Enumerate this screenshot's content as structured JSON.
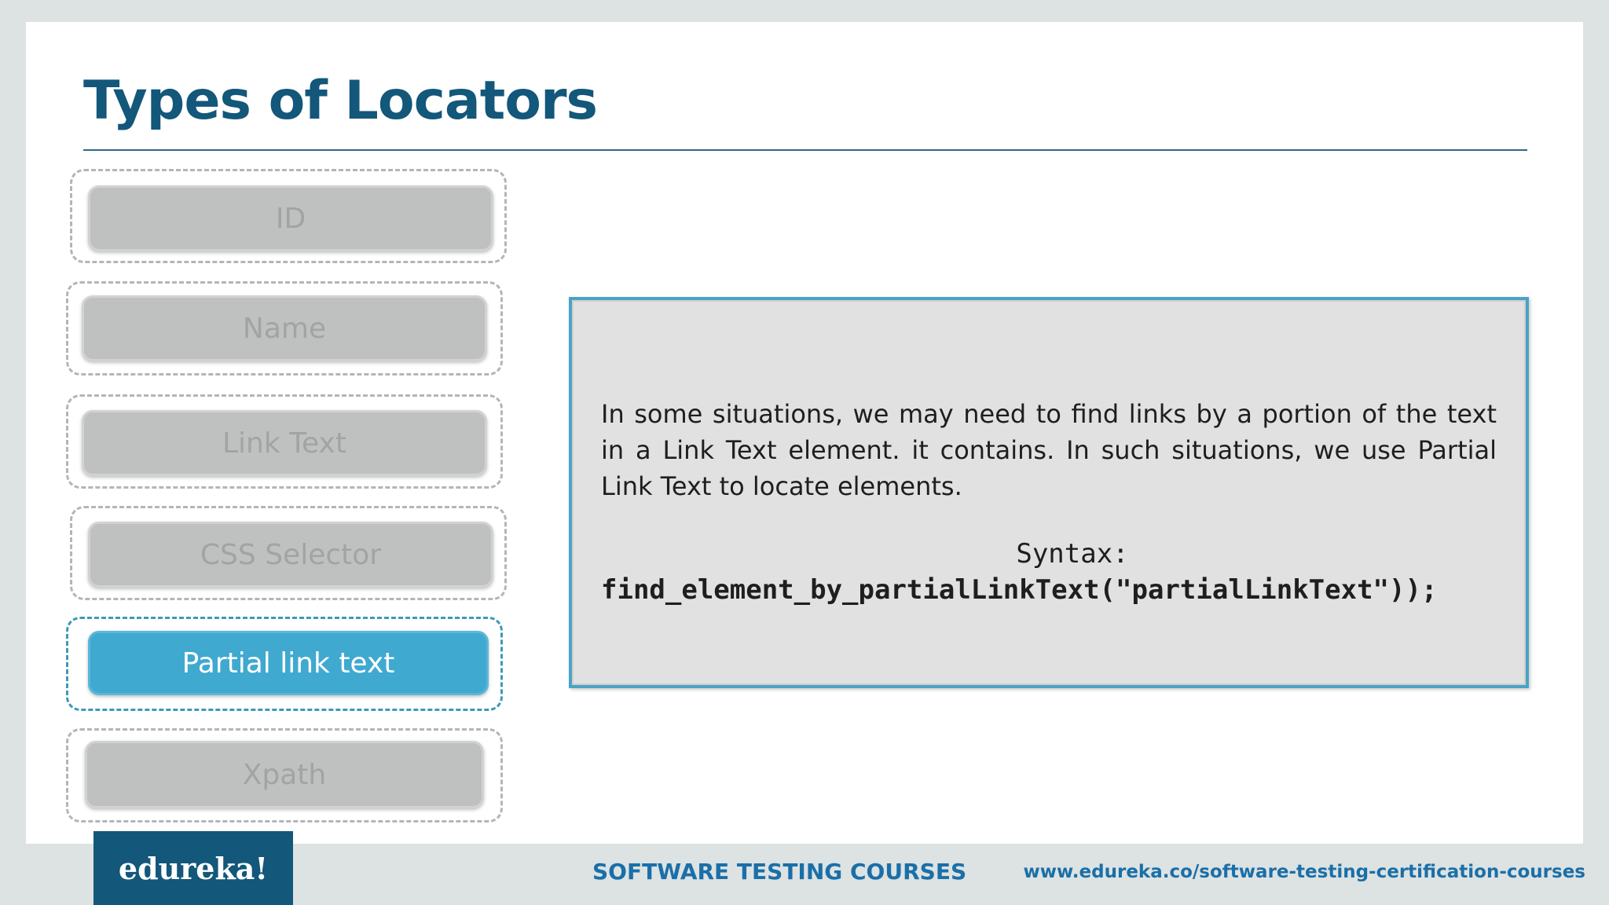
{
  "slide": {
    "title": "Types of Locators"
  },
  "locators": [
    {
      "label": "ID",
      "active": false
    },
    {
      "label": "Name",
      "active": false
    },
    {
      "label": "Link Text",
      "active": false
    },
    {
      "label": "CSS Selector",
      "active": false
    },
    {
      "label": "Partial link text",
      "active": true
    },
    {
      "label": "Xpath",
      "active": false
    }
  ],
  "info": {
    "description": "In some situations, we may need to find links by a portion of the text in a Link Text element. it contains. In such situations, we use Partial Link Text to locate elements.",
    "syntax_label": "Syntax:",
    "syntax_code": "find_element_by_partialLinkText(\"partialLinkText\"));"
  },
  "footer": {
    "logo_text": "edureka!",
    "course": "SOFTWARE TESTING COURSES",
    "url": "www.edureka.co/software-testing-certification-courses"
  },
  "colors": {
    "title": "#13577a",
    "active_button": "#3fa9d0",
    "info_border": "#4aa3c6",
    "footer_logo_bg": "#13577a",
    "footer_text": "#1a6fa8"
  }
}
